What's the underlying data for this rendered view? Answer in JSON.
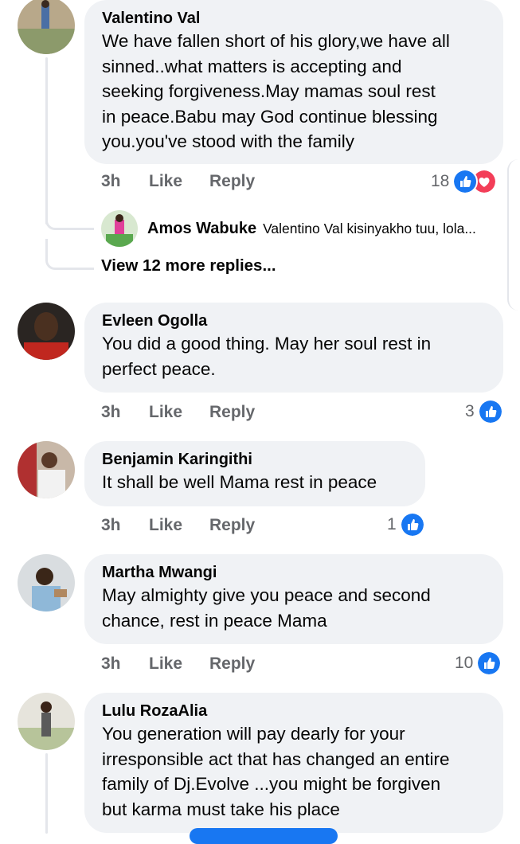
{
  "comments": [
    {
      "name": "Valentino Val",
      "lines": [
        "We have fallen short of his glory,we have all",
        "sinned..what matters is accepting and",
        "seeking forgiveness.May mamas soul rest",
        "in peace.Babu may God continue blessing",
        "you.you've stood with the family"
      ],
      "time": "3h",
      "like": "Like",
      "reply": "Reply",
      "reaction_count": "18",
      "reactions": [
        "like",
        "love"
      ]
    },
    {
      "name": "Evleen Ogolla",
      "lines": [
        "You did a good thing. May her soul rest in",
        "perfect peace."
      ],
      "time": "3h",
      "like": "Like",
      "reply": "Reply",
      "reaction_count": "3",
      "reactions": [
        "like"
      ]
    },
    {
      "name": "Benjamin Karingithi",
      "lines": [
        "It shall be well Mama rest in peace"
      ],
      "time": "3h",
      "like": "Like",
      "reply": "Reply",
      "reaction_count": "1",
      "reactions": [
        "like"
      ]
    },
    {
      "name": "Martha Mwangi",
      "lines": [
        "May almighty give you peace and second",
        "chance, rest in peace Mama"
      ],
      "time": "3h",
      "like": "Like",
      "reply": "Reply",
      "reaction_count": "10",
      "reactions": [
        "like"
      ]
    },
    {
      "name": "Lulu RozaAlia",
      "lines": [
        "You generation will pay dearly for your",
        "irresponsible act that has changed an entire",
        "family of Dj.Evolve ...you might be forgiven",
        "but karma must take his place"
      ]
    }
  ],
  "reply_preview": {
    "name": "Amos Wabuke",
    "text": "Valentino Val kisinyakho tuu, lola..."
  },
  "view_more": "View 12 more replies...",
  "colors": {
    "bubble": "#f0f2f5",
    "like_blue": "#1877f2",
    "love_red": "#f33e58",
    "meta_gray": "#65676b"
  }
}
